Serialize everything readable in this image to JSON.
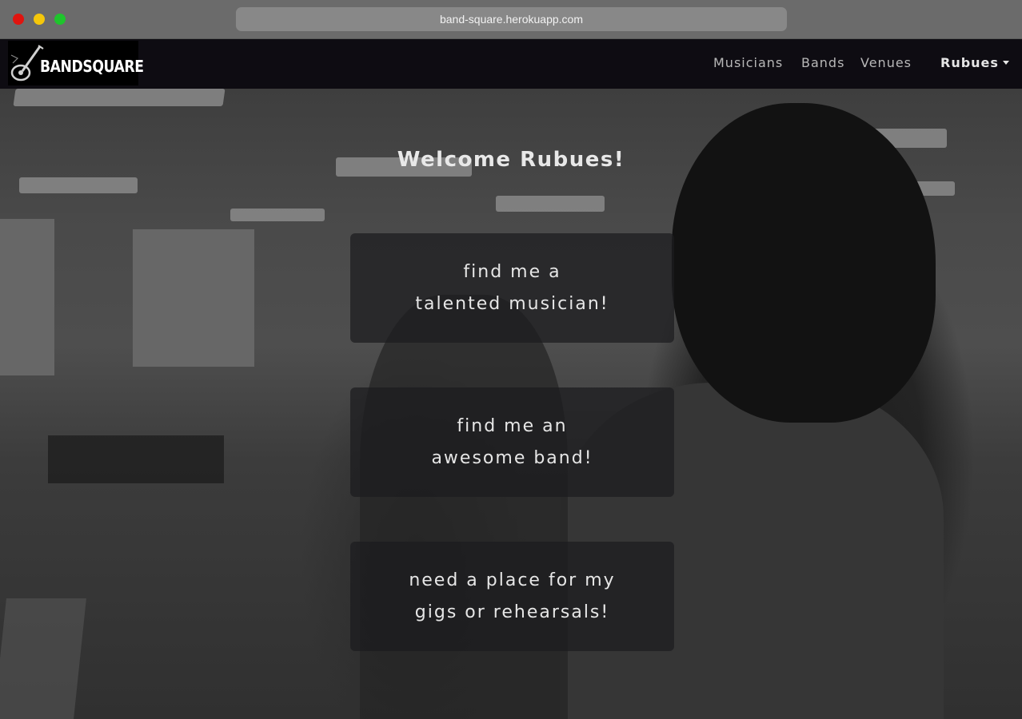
{
  "browser": {
    "url": "band-square.herokuapp.com"
  },
  "navbar": {
    "brand": "BANDSQUARE",
    "links": [
      "Musicians",
      "Bands",
      "Venues"
    ],
    "user": "Rubues"
  },
  "main": {
    "welcome": "Welcome Rubues!",
    "cards": [
      {
        "line1": "find me a",
        "line2": "talented musician!"
      },
      {
        "line1": "find me an",
        "line2": "awesome band!"
      },
      {
        "line1": "need a place for my",
        "line2": "gigs or rehearsals!"
      }
    ]
  },
  "colors": {
    "navbar_bg": "#0e0c12",
    "card_bg": "rgba(28,28,30,0.72)",
    "text": "#e6e6e6"
  }
}
